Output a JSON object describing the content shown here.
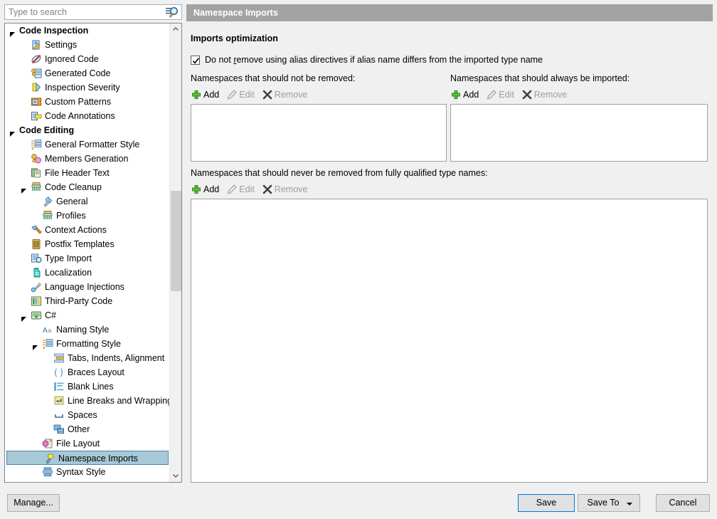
{
  "search": {
    "placeholder": "Type to search",
    "value": "",
    "icon": "search-icon"
  },
  "tree": {
    "items": [
      {
        "label": "Code Inspection",
        "indent": 0,
        "group": true,
        "expander": "down",
        "icon": "none",
        "selected": false
      },
      {
        "label": "Settings",
        "indent": 1,
        "group": false,
        "expander": "none",
        "icon": "settings",
        "selected": false
      },
      {
        "label": "Ignored Code",
        "indent": 1,
        "group": false,
        "expander": "none",
        "icon": "ignored-code",
        "selected": false
      },
      {
        "label": "Generated Code",
        "indent": 1,
        "group": false,
        "expander": "none",
        "icon": "generated-code",
        "selected": false
      },
      {
        "label": "Inspection Severity",
        "indent": 1,
        "group": false,
        "expander": "none",
        "icon": "inspection-severity",
        "selected": false
      },
      {
        "label": "Custom Patterns",
        "indent": 1,
        "group": false,
        "expander": "none",
        "icon": "custom-patterns",
        "selected": false
      },
      {
        "label": "Code Annotations",
        "indent": 1,
        "group": false,
        "expander": "none",
        "icon": "code-annotations",
        "selected": false
      },
      {
        "label": "Code Editing",
        "indent": 0,
        "group": true,
        "expander": "down",
        "icon": "none",
        "selected": false
      },
      {
        "label": "General Formatter Style",
        "indent": 1,
        "group": false,
        "expander": "none",
        "icon": "formatter-style",
        "selected": false
      },
      {
        "label": "Members Generation",
        "indent": 1,
        "group": false,
        "expander": "none",
        "icon": "members-generation",
        "selected": false
      },
      {
        "label": "File Header Text",
        "indent": 1,
        "group": false,
        "expander": "none",
        "icon": "file-header",
        "selected": false
      },
      {
        "label": "Code Cleanup",
        "indent": 1,
        "group": false,
        "expander": "down",
        "icon": "code-cleanup",
        "selected": false
      },
      {
        "label": "General",
        "indent": 2,
        "group": false,
        "expander": "none",
        "icon": "wrench",
        "selected": false
      },
      {
        "label": "Profiles",
        "indent": 2,
        "group": false,
        "expander": "none",
        "icon": "code-cleanup",
        "selected": false
      },
      {
        "label": "Context Actions",
        "indent": 1,
        "group": false,
        "expander": "none",
        "icon": "hammer",
        "selected": false
      },
      {
        "label": "Postfix Templates",
        "indent": 1,
        "group": false,
        "expander": "none",
        "icon": "postfix",
        "selected": false
      },
      {
        "label": "Type Import",
        "indent": 1,
        "group": false,
        "expander": "none",
        "icon": "type-import",
        "selected": false
      },
      {
        "label": "Localization",
        "indent": 1,
        "group": false,
        "expander": "none",
        "icon": "localization",
        "selected": false
      },
      {
        "label": "Language Injections",
        "indent": 1,
        "group": false,
        "expander": "none",
        "icon": "injections",
        "selected": false
      },
      {
        "label": "Third-Party Code",
        "indent": 1,
        "group": false,
        "expander": "none",
        "icon": "third-party",
        "selected": false
      },
      {
        "label": "C#",
        "indent": 1,
        "group": false,
        "expander": "down",
        "icon": "csharp",
        "selected": false
      },
      {
        "label": "Naming Style",
        "indent": 2,
        "group": false,
        "expander": "none",
        "icon": "naming-style",
        "selected": false
      },
      {
        "label": "Formatting Style",
        "indent": 2,
        "group": false,
        "expander": "down",
        "icon": "formatter-style",
        "selected": false
      },
      {
        "label": "Tabs, Indents, Alignment",
        "indent": 3,
        "group": false,
        "expander": "none",
        "icon": "tabs-indents",
        "selected": false
      },
      {
        "label": "Braces Layout",
        "indent": 3,
        "group": false,
        "expander": "none",
        "icon": "braces",
        "selected": false
      },
      {
        "label": "Blank Lines",
        "indent": 3,
        "group": false,
        "expander": "none",
        "icon": "blank-lines",
        "selected": false
      },
      {
        "label": "Line Breaks and Wrapping",
        "indent": 3,
        "group": false,
        "expander": "none",
        "icon": "line-breaks",
        "selected": false
      },
      {
        "label": "Spaces",
        "indent": 3,
        "group": false,
        "expander": "none",
        "icon": "spaces",
        "selected": false
      },
      {
        "label": "Other",
        "indent": 3,
        "group": false,
        "expander": "none",
        "icon": "other",
        "selected": false
      },
      {
        "label": "File Layout",
        "indent": 2,
        "group": false,
        "expander": "none",
        "icon": "file-layout",
        "selected": false
      },
      {
        "label": "Namespace Imports",
        "indent": 2,
        "group": false,
        "expander": "none",
        "icon": "namespace-imports",
        "selected": true
      },
      {
        "label": "Syntax Style",
        "indent": 2,
        "group": false,
        "expander": "none",
        "icon": "syntax-style",
        "selected": false
      }
    ],
    "scrollbar": {
      "up_icon": "chevron-up-icon",
      "down_icon": "chevron-down-icon"
    }
  },
  "panel": {
    "header": "Namespace Imports",
    "section_title": "Imports optimization",
    "checkbox": {
      "checked": true,
      "text_before": "Do not ",
      "mnemonic": "r",
      "text_after": "emove using alias directives if alias name differs from the imported type name"
    },
    "lists": [
      {
        "label": "Namespaces that should not be removed:",
        "toolbar": [
          {
            "label": "Add",
            "icon": "plus-icon",
            "enabled": true
          },
          {
            "label": "Edit",
            "icon": "pencil-icon",
            "enabled": false
          },
          {
            "label": "Remove",
            "icon": "x-icon",
            "enabled": false
          }
        ],
        "items": []
      },
      {
        "label": "Namespaces that should always be imported:",
        "toolbar": [
          {
            "label": "Add",
            "icon": "plus-icon",
            "enabled": true
          },
          {
            "label": "Edit",
            "icon": "pencil-icon",
            "enabled": false
          },
          {
            "label": "Remove",
            "icon": "x-icon",
            "enabled": false
          }
        ],
        "items": []
      },
      {
        "label": "Namespaces that should never be removed from fully qualified type names:",
        "toolbar": [
          {
            "label": "Add",
            "icon": "plus-icon",
            "enabled": true
          },
          {
            "label": "Edit",
            "icon": "pencil-icon",
            "enabled": false
          },
          {
            "label": "Remove",
            "icon": "x-icon",
            "enabled": false
          }
        ],
        "items": []
      }
    ]
  },
  "footer": {
    "manage": "Manage...",
    "save": "Save",
    "save_to": "Save To",
    "cancel": "Cancel"
  },
  "colors": {
    "window_bg": "#f0f0f0",
    "header_bar": "#a3a3a3",
    "selection_bg": "#a7c8d7",
    "selection_border": "#4a87a8",
    "accent_focus": "#0078d7",
    "disabled_text": "#9d9d9d",
    "add_icon_green": "#4caf2f"
  }
}
